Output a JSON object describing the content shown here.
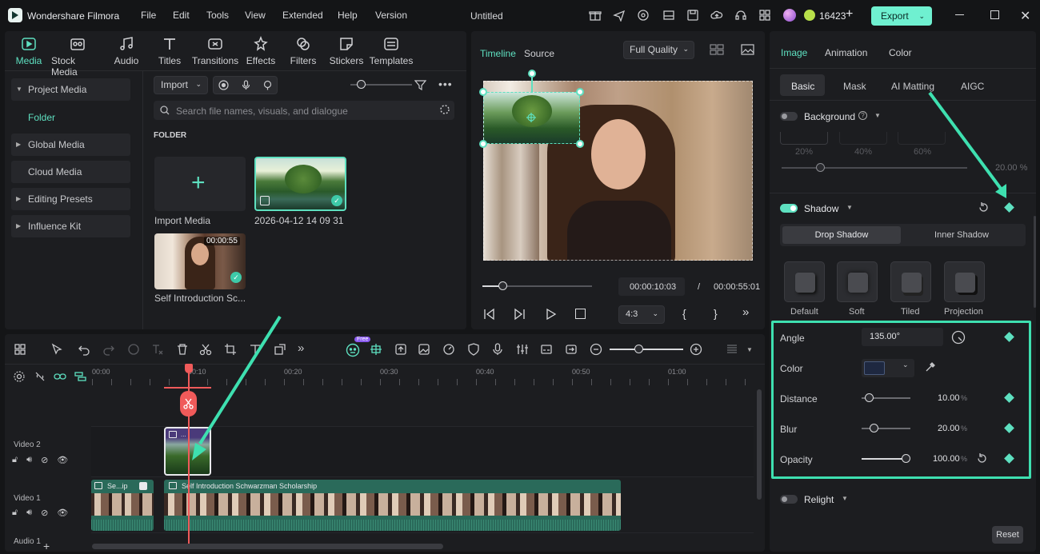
{
  "app": {
    "name": "Wondershare Filmora",
    "doc_title": "Untitled",
    "credits": "16423",
    "export_label": "Export"
  },
  "menu": [
    "File",
    "Edit",
    "Tools",
    "View",
    "Extended",
    "Help",
    "Version"
  ],
  "media_tabs": [
    "Media",
    "Stock Media",
    "Audio",
    "Titles",
    "Transitions",
    "Effects",
    "Filters",
    "Stickers",
    "Templates"
  ],
  "sidebar": {
    "items": [
      "Project Media",
      "Folder",
      "Global Media",
      "Cloud Media",
      "Editing Presets",
      "Influence Kit"
    ]
  },
  "library": {
    "import_label": "Import",
    "search_placeholder": "Search file names, visuals, and dialogue",
    "folder_heading": "FOLDER",
    "import_media_label": "Import Media",
    "clip1_name": "2026-04-12 14 09 31",
    "clip2_name": "Self Introduction Sc...",
    "clip2_duration": "00:00:55"
  },
  "preview": {
    "tabs": [
      "Timeline",
      "Source"
    ],
    "quality": "Full Quality",
    "current_time": "00:00:10:03",
    "separator": "/",
    "total_time": "00:00:55:01",
    "aspect": "4:3",
    "brace_open": "{",
    "brace_close": "}",
    "playhead_progress": 0.18
  },
  "inspector": {
    "top_tabs": [
      "Image",
      "Animation",
      "Color"
    ],
    "sub_tabs": [
      "Basic",
      "Mask",
      "AI Matting",
      "AIGC"
    ],
    "background_label": "Background",
    "bg_percents": [
      "20%",
      "40%",
      "60%"
    ],
    "bg_value": "20.00 %",
    "shadow_label": "Shadow",
    "shadow_types": [
      "Drop Shadow",
      "Inner Shadow"
    ],
    "presets": [
      "Default",
      "Soft",
      "Tiled",
      "Projection"
    ],
    "params": {
      "angle_label": "Angle",
      "angle_value": "135.00°",
      "color_label": "Color",
      "distance_label": "Distance",
      "distance_value": "10.00",
      "distance_unit": "%",
      "blur_label": "Blur",
      "blur_value": "20.00",
      "blur_unit": "%",
      "opacity_label": "Opacity",
      "opacity_value": "100.00",
      "opacity_unit": "%"
    },
    "relight_label": "Relight",
    "reset_label": "Reset"
  },
  "timeline": {
    "ruler": [
      "00:00",
      "00:10",
      "00:20",
      "00:30",
      "00:40",
      "00:50",
      "01:00"
    ],
    "tracks": [
      "Video 2",
      "Video 1",
      "Audio 1"
    ],
    "clip_a_label": "Se...ip",
    "clip_b_label": "Self Introduction Schwarzman Scholarship",
    "free_badge": "Free"
  },
  "colors": {
    "accent": "#5ee0c0",
    "playhead": "#f05a5a",
    "highlight": "#3ee0b0"
  }
}
